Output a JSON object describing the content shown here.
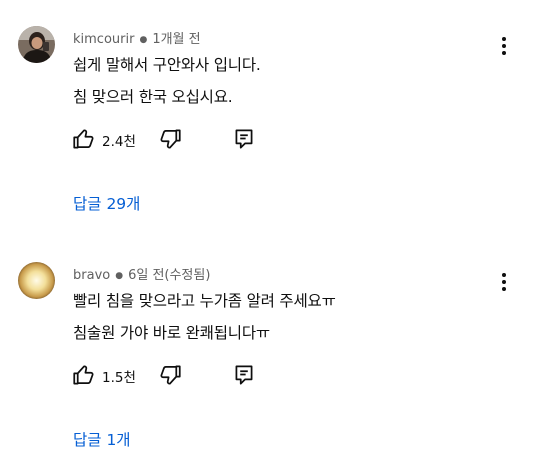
{
  "comments": [
    {
      "author": "kimcourir",
      "time": "1개월 전",
      "lines": [
        "쉽게 말해서 구안와사 입니다.",
        "침 맞으러 한국 오십시요."
      ],
      "likes": "2.4천",
      "replies_label": "답글 29개",
      "avatar": "person-photo"
    },
    {
      "author": "bravo",
      "time": "6일 전(수정됨)",
      "lines": [
        "빨리 침을 맞으라고 누가좀 알려 주세요ㅠ",
        "침술원 가야 바로 완쾌됩니다ㅠ"
      ],
      "likes": "1.5천",
      "replies_label": "답글 1개",
      "avatar": "glowing-orb"
    }
  ],
  "icons": {
    "like": "thumbs-up-icon",
    "dislike": "thumbs-down-icon",
    "reply": "reply-comment-icon",
    "more": "more-vert-icon"
  },
  "colors": {
    "link": "#065fd4",
    "meta": "#606060",
    "text": "#0f0f0f"
  }
}
